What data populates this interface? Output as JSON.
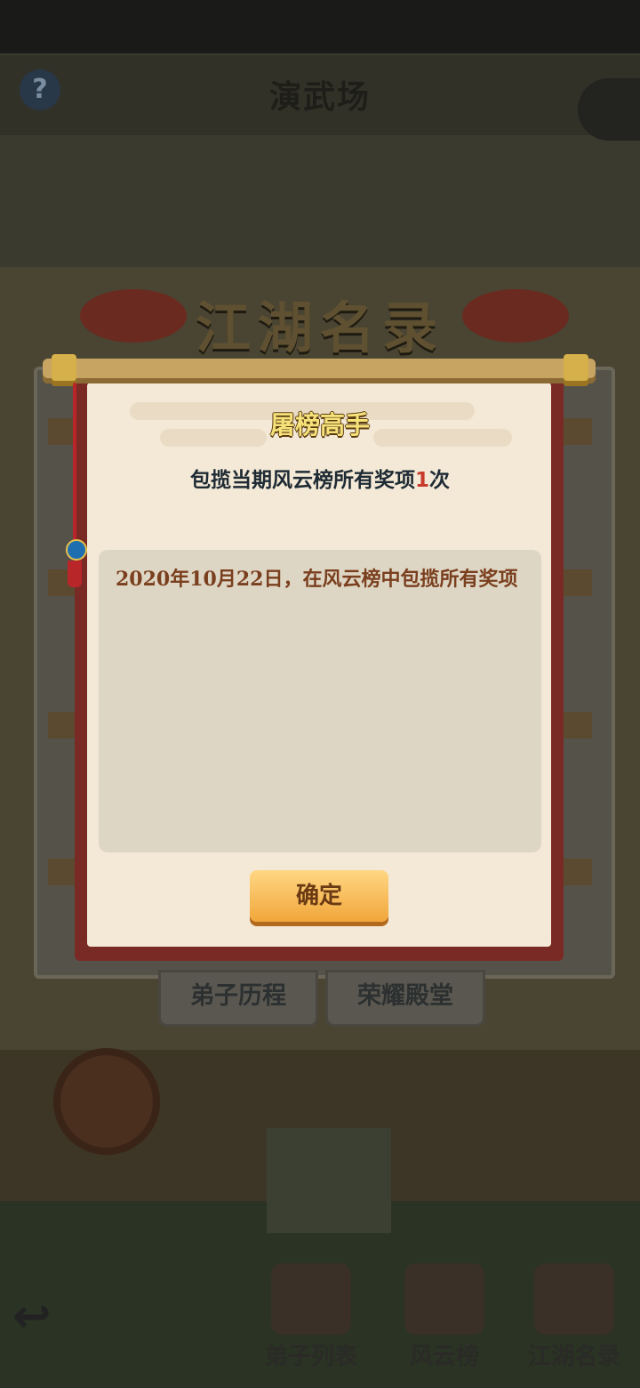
{
  "scene": {
    "help_icon": "question-icon",
    "title": "演武场",
    "banner_title": "江湖名录",
    "tabs": [
      "弟子历程",
      "荣耀殿堂"
    ]
  },
  "bottom_nav": {
    "back_icon": "back-arrow-icon",
    "items": [
      {
        "label": "弟子列表",
        "icon": "disciple-icon"
      },
      {
        "label": "风云榜",
        "icon": "scroll-icon"
      },
      {
        "label": "江湖名录",
        "icon": "book-icon"
      }
    ]
  },
  "popup": {
    "title": "屠榜高手",
    "desc_prefix": "包揽当期风云榜所有奖项",
    "desc_count": "1",
    "desc_suffix": "次",
    "detail": "2020年10月22日，在风云榜中包揽所有奖项",
    "confirm_label": "确定"
  },
  "colors": {
    "overlay": "#2b2a23",
    "paper": "#f3e9d6",
    "button": "#f1a63a",
    "count_highlight": "#c83a2a"
  }
}
